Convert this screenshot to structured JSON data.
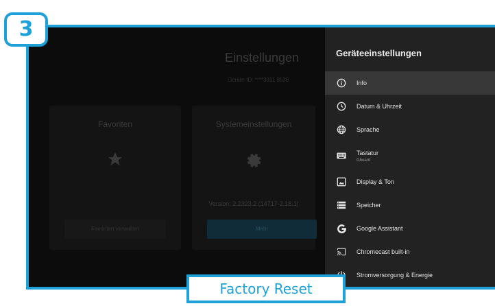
{
  "step_number": "3",
  "background": {
    "title": "Einstellungen",
    "device_id": "Geräte-ID: ****3311 8538",
    "favorites_card": {
      "title": "Favoriten",
      "icon": "star-icon",
      "button_label": "Favoriten verwalten"
    },
    "system_card": {
      "title": "Systemeinstellungen",
      "icon": "gear-icon",
      "version": "Version: 2.2323.2 (14717-2.18.1)",
      "button_label": "Mehr"
    }
  },
  "panel": {
    "title": "Geräteeinstellungen",
    "items": [
      {
        "label": "Info",
        "icon": "info-icon",
        "selected": true
      },
      {
        "label": "Datum & Uhrzeit",
        "icon": "clock-icon"
      },
      {
        "label": "Sprache",
        "icon": "globe-icon"
      },
      {
        "label": "Tastatur",
        "sublabel": "Gboard",
        "icon": "keyboard-icon"
      },
      {
        "label": "Display & Ton",
        "icon": "image-icon"
      },
      {
        "label": "Speicher",
        "icon": "storage-icon"
      },
      {
        "label": "Google Assistant",
        "icon": "google-g-icon"
      },
      {
        "label": "Chromecast built-in",
        "icon": "cast-icon"
      },
      {
        "label": "Stromversorgung & Energie",
        "icon": "power-icon"
      }
    ]
  },
  "callout": {
    "label": "Factory Reset"
  },
  "colors": {
    "accent": "#1ea0d8",
    "panel_bg": "#222222",
    "selected_bg": "#383838"
  }
}
